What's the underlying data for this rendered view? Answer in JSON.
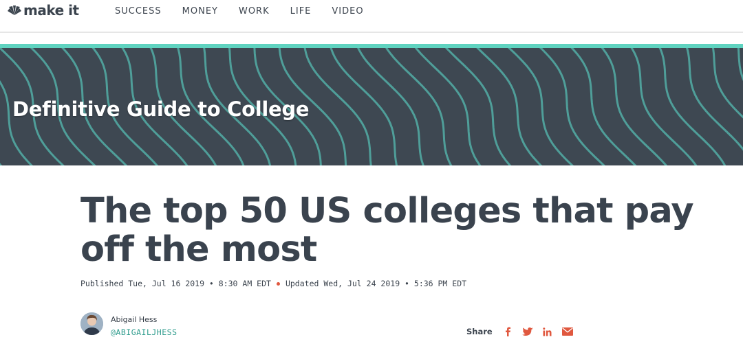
{
  "nav": {
    "logo_text": "make it",
    "items": [
      "SUCCESS",
      "MONEY",
      "WORK",
      "LIFE",
      "VIDEO"
    ]
  },
  "banner": {
    "title": "Definitive Guide to College"
  },
  "article": {
    "headline": "The top 50 US colleges that pay off the most",
    "published": "Published Tue, Jul 16 2019 • 8:30 AM EDT",
    "updated": "Updated Wed, Jul 24 2019 • 5:36 PM EDT",
    "author_name": "Abigail Hess",
    "author_handle": "@ABIGAILJHESS"
  },
  "share": {
    "label": "Share",
    "icons": [
      "facebook-icon",
      "twitter-icon",
      "linkedin-icon",
      "email-icon"
    ]
  },
  "colors": {
    "banner_bg": "#3e4852",
    "accent": "#5fd3c0",
    "wave": "#4f9e99",
    "share_icon": "#e0583f",
    "handle": "#2f9c8d"
  }
}
